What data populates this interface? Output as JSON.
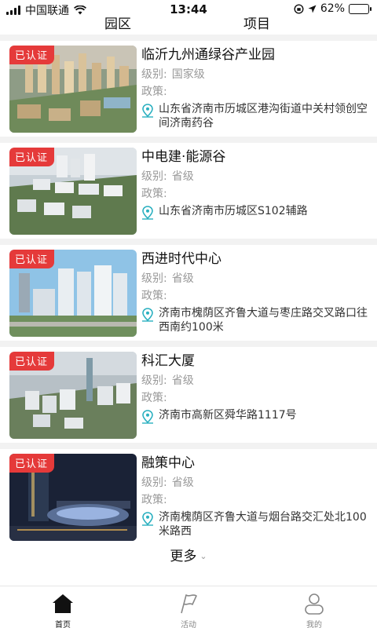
{
  "status_bar": {
    "carrier": "中国联通",
    "time": "13:44",
    "battery": "62%"
  },
  "top_tabs": [
    "园区",
    "项目"
  ],
  "items": [
    {
      "badge": "已认证",
      "name": "临沂九州通绿谷产业园",
      "level_label": "级别:",
      "level": "国家级",
      "policy_label": "政策:",
      "address": "山东省济南市历城区港沟街道中关村领创空间济南药谷"
    },
    {
      "badge": "已认证",
      "name": "中电建·能源谷",
      "level_label": "级别:",
      "level": "省级",
      "policy_label": "政策:",
      "address": "山东省济南市历城区S102辅路"
    },
    {
      "badge": "已认证",
      "name": "西进时代中心",
      "level_label": "级别:",
      "level": "省级",
      "policy_label": "政策:",
      "address": "济南市槐荫区齐鲁大道与枣庄路交叉路口往西南约100米"
    },
    {
      "badge": "已认证",
      "name": "科汇大厦",
      "level_label": "级别:",
      "level": "省级",
      "policy_label": "政策:",
      "address": "济南市高新区舜华路1117号"
    },
    {
      "badge": "已认证",
      "name": "融策中心",
      "level_label": "级别:",
      "level": "省级",
      "policy_label": "政策:",
      "address": "济南槐荫区齐鲁大道与烟台路交汇处北100米路西"
    }
  ],
  "more_label": "更多",
  "bottom_nav": [
    {
      "label": "首页",
      "icon": "home-icon",
      "active": true
    },
    {
      "label": "活动",
      "icon": "flag-icon",
      "active": false
    },
    {
      "label": "我的",
      "icon": "person-icon",
      "active": false
    }
  ],
  "colors": {
    "badge": "#e53a3a",
    "pin": "#2bb0c0",
    "muted": "#999999"
  }
}
